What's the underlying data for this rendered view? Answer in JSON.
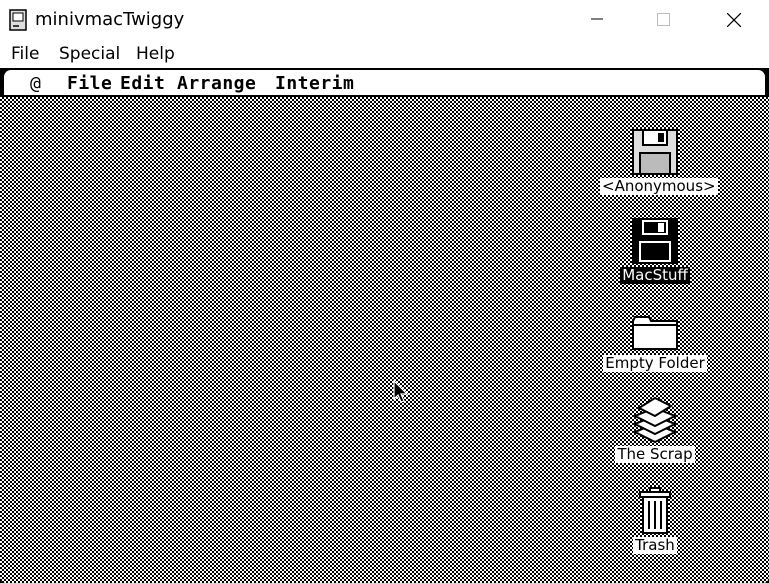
{
  "window": {
    "title": "minivmacTwiggy",
    "app_icon": "mac-computer-icon",
    "controls": [
      "minimize-icon",
      "maximize-icon",
      "close-icon"
    ]
  },
  "win_menu": {
    "items": [
      "File",
      "Special",
      "Help"
    ]
  },
  "mac_menu": {
    "apple": "@",
    "items": [
      "File",
      "Edit",
      "Arrange",
      "Interim"
    ]
  },
  "desktop": {
    "icons": [
      {
        "label": "<Anonymous>",
        "icon": "floppy-disk-icon",
        "selected": false
      },
      {
        "label": "MacStuff",
        "icon": "floppy-disk-icon",
        "selected": true
      },
      {
        "label": "Empty Folder",
        "icon": "folder-icon",
        "selected": false
      },
      {
        "label": "The Scrap",
        "icon": "scrapbook-icon",
        "selected": false
      },
      {
        "label": "Trash",
        "icon": "trash-icon",
        "selected": false
      }
    ]
  },
  "colors": {
    "desktop_pattern_dark": "#000000",
    "desktop_pattern_light": "#ffffff",
    "chrome": "#ffffff"
  }
}
